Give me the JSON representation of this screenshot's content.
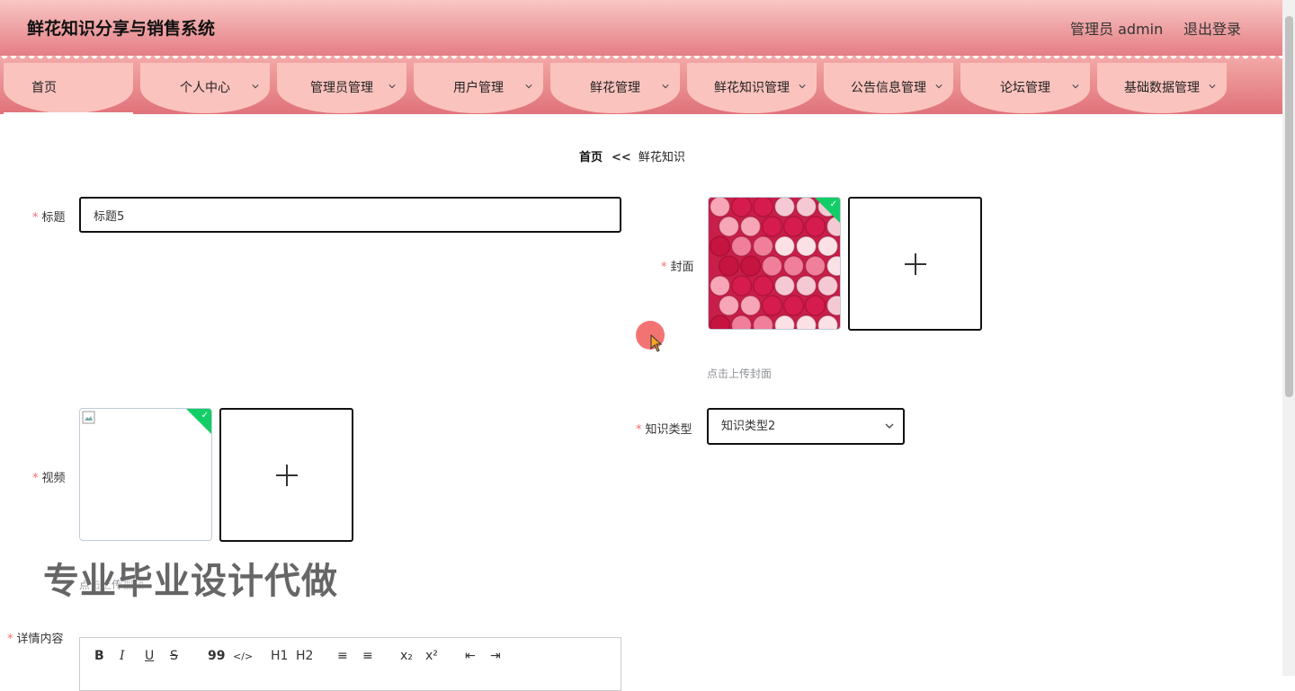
{
  "header": {
    "title": "鲜花知识分享与销售系统",
    "user": "管理员 admin",
    "logout": "退出登录"
  },
  "nav": [
    {
      "label": "首页",
      "dropdown": false,
      "active": true
    },
    {
      "label": "个人中心",
      "dropdown": true
    },
    {
      "label": "管理员管理",
      "dropdown": true
    },
    {
      "label": "用户管理",
      "dropdown": true
    },
    {
      "label": "鲜花管理",
      "dropdown": true
    },
    {
      "label": "鲜花知识管理",
      "dropdown": true
    },
    {
      "label": "公告信息管理",
      "dropdown": true
    },
    {
      "label": "论坛管理",
      "dropdown": true
    },
    {
      "label": "基础数据管理",
      "dropdown": true
    }
  ],
  "breadcrumb": {
    "home": "首页",
    "sep": "<<",
    "current": "鲜花知识"
  },
  "form": {
    "required_mark": "*",
    "title_label": "标题",
    "title_value": "标题5",
    "cover_label": "封面",
    "cover_hint": "点击上传封面",
    "video_label": "视频",
    "video_hint": "点击上传视频",
    "type_label": "知识类型",
    "type_value": "知识类型2",
    "detail_label": "详情内容"
  },
  "editor": {
    "bold": "B",
    "italic": "I",
    "underline": "U",
    "strike": "S",
    "quote": "99",
    "code": "</>",
    "h1": "H1",
    "h2": "H2",
    "ol": "≡",
    "ul": "≡",
    "sub": "x₂",
    "sup": "x²",
    "outdent": "⇤",
    "indent": "⇥"
  },
  "watermark": "专业毕业设计代做",
  "colors": {
    "accent": "#e47d84",
    "nav_item": "#fbc3bd",
    "success": "#13ce66",
    "required": "#f56c6c"
  }
}
